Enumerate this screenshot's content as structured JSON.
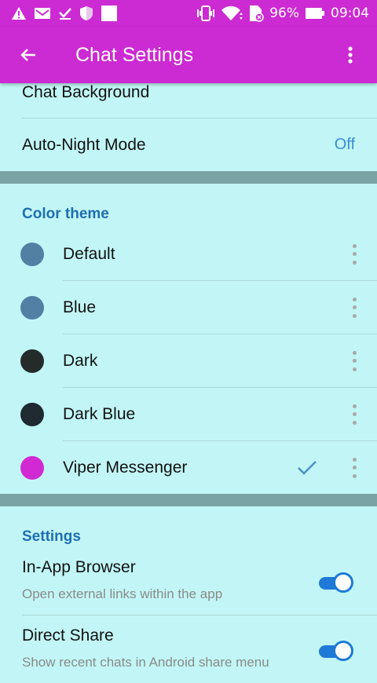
{
  "status_bar": {
    "battery": "96%",
    "time": "09:04"
  },
  "app_bar": {
    "title": "Chat Settings"
  },
  "top_rows": [
    {
      "label": "Chat Background",
      "value": ""
    },
    {
      "label": "Auto-Night Mode",
      "value": "Off"
    }
  ],
  "color_theme": {
    "header": "Color theme",
    "themes": [
      {
        "label": "Default",
        "color": "#527fa4",
        "selected": false
      },
      {
        "label": "Blue",
        "color": "#527fa4",
        "selected": false
      },
      {
        "label": "Dark",
        "color": "#252b2b",
        "selected": false
      },
      {
        "label": "Dark Blue",
        "color": "#1f2a33",
        "selected": false
      },
      {
        "label": "Viper Messenger",
        "color": "#d12ad3",
        "selected": true
      }
    ]
  },
  "settings": {
    "header": "Settings",
    "items": [
      {
        "title": "In-App Browser",
        "subtitle": "Open external links within the app",
        "enabled": true
      },
      {
        "title": "Direct Share",
        "subtitle": "Show recent chats in Android share menu",
        "enabled": true
      }
    ]
  },
  "colors": {
    "accent": "#cc2ad2",
    "background": "#c2f6f6",
    "section_header": "#1e6fb0",
    "toggle": "#1e7ad6"
  }
}
